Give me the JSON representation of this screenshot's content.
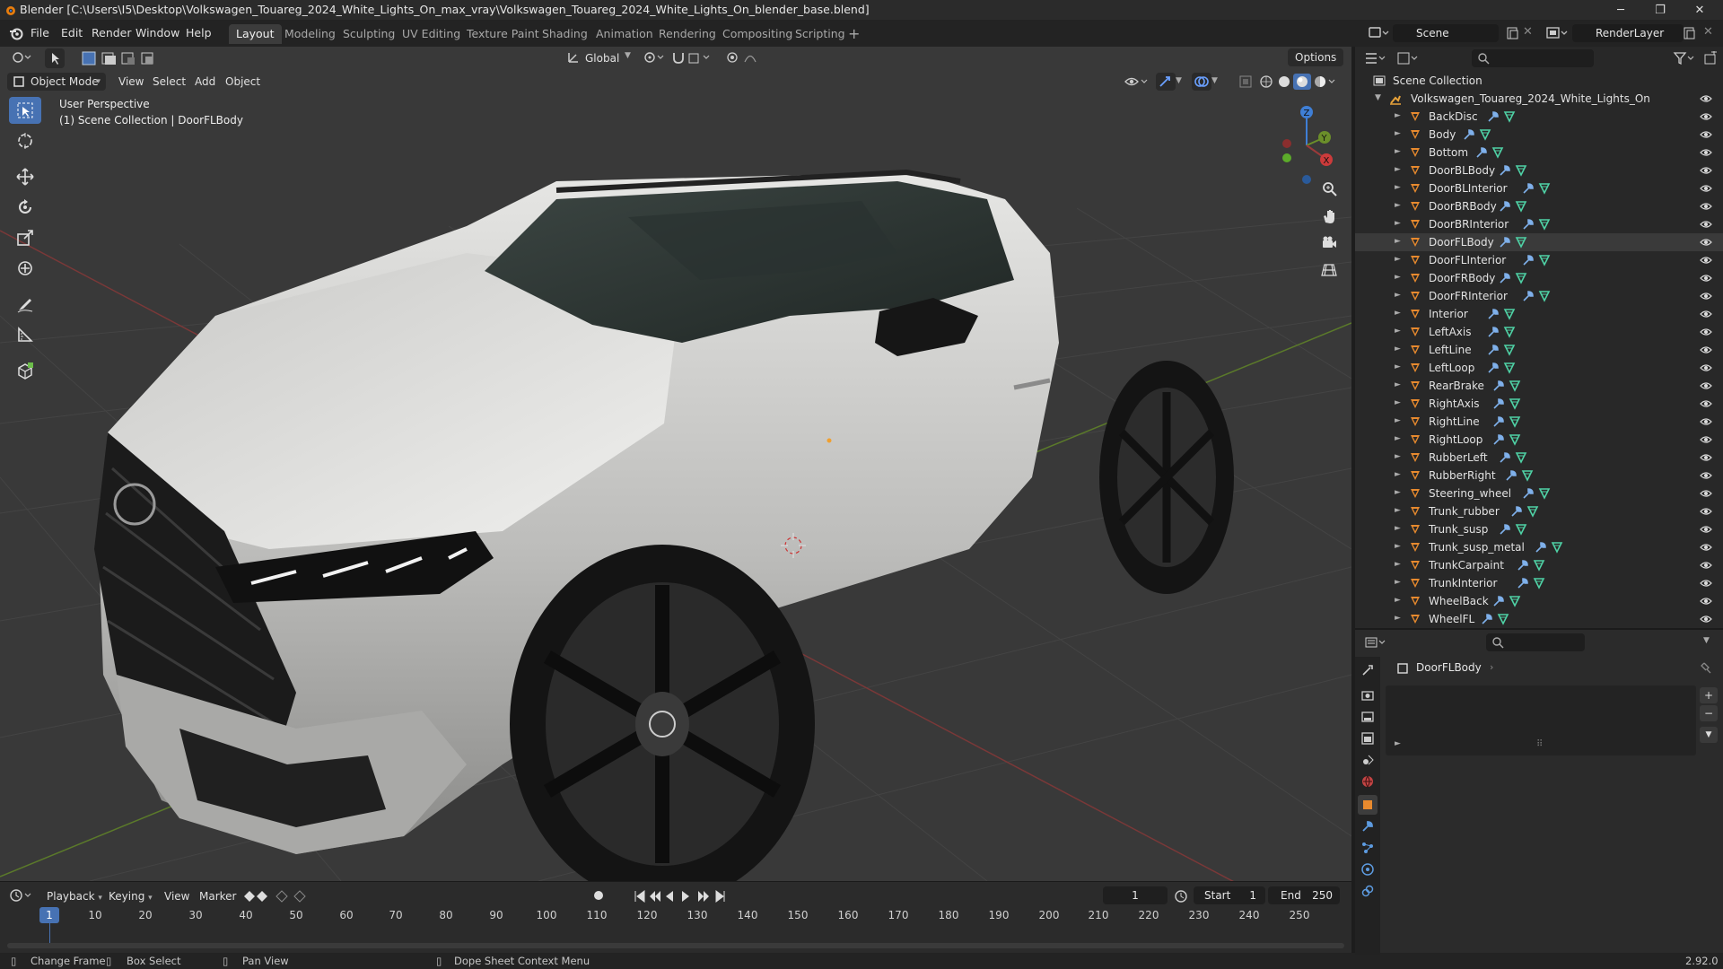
{
  "window": {
    "title": "Blender [C:\\Users\\I5\\Desktop\\Volkswagen_Touareg_2024_White_Lights_On_max_vray\\Volkswagen_Touareg_2024_White_Lights_On_blender_base.blend]",
    "controls": [
      "minimize",
      "maximize",
      "close"
    ]
  },
  "menu": [
    "File",
    "Edit",
    "Render",
    "Window",
    "Help"
  ],
  "workspaces": [
    {
      "label": "Layout",
      "active": true
    },
    {
      "label": "Modeling"
    },
    {
      "label": "Sculpting"
    },
    {
      "label": "UV Editing"
    },
    {
      "label": "Texture Paint"
    },
    {
      "label": "Shading"
    },
    {
      "label": "Animation"
    },
    {
      "label": "Rendering"
    },
    {
      "label": "Compositing"
    },
    {
      "label": "Scripting"
    }
  ],
  "scene": {
    "name": "Scene",
    "render_layer": "RenderLayer"
  },
  "viewport": {
    "mode": "Object Mode",
    "menus": [
      "View",
      "Select",
      "Add",
      "Object"
    ],
    "transform_orientation": "Global",
    "options_label": "Options",
    "overlay_line1": "User Perspective",
    "overlay_line2": "(1) Scene Collection | DoorFLBody",
    "tools": [
      "select-box",
      "cursor",
      "move",
      "rotate",
      "scale",
      "transform",
      "annotate",
      "measure",
      "add-cube"
    ],
    "gizmo_axes": [
      "X",
      "Y",
      "Z"
    ],
    "colors": {
      "background": "#393939",
      "x_axis": "#9b3a3a",
      "y_axis": "#6b8f2a",
      "z_axis": "#3f7fd6",
      "active_tool": "#4772b3"
    }
  },
  "outliner": {
    "root": "Scene Collection",
    "collection": "Volkswagen_Touareg_2024_White_Lights_On",
    "selected": "DoorFLBody",
    "objects": [
      "BackDisc",
      "Body",
      "Bottom",
      "DoorBLBody",
      "DoorBLInterior",
      "DoorBRBody",
      "DoorBRInterior",
      "DoorFLBody",
      "DoorFLInterior",
      "DoorFRBody",
      "DoorFRInterior",
      "Interior",
      "LeftAxis",
      "LeftLine",
      "LeftLoop",
      "RearBrake",
      "RightAxis",
      "RightLine",
      "RightLoop",
      "RubberLeft",
      "RubberRight",
      "Steering_wheel",
      "Trunk_rubber",
      "Trunk_susp",
      "Trunk_susp_metal",
      "TrunkCarpaint",
      "TrunkInterior",
      "WheelBack",
      "WheelFL"
    ]
  },
  "properties": {
    "object_name": "DoorFLBody",
    "tabs": [
      "tool",
      "render",
      "output",
      "view-layer",
      "scene",
      "world",
      "object",
      "modifiers",
      "particles",
      "physics",
      "constraints"
    ]
  },
  "timeline": {
    "menus": [
      "Playback",
      "Keying",
      "View",
      "Marker"
    ],
    "current_frame": "1",
    "start_label": "Start",
    "start": "1",
    "end_label": "End",
    "end": "250",
    "ticks": [
      "1",
      "10",
      "20",
      "30",
      "40",
      "50",
      "60",
      "70",
      "80",
      "90",
      "100",
      "110",
      "120",
      "130",
      "140",
      "150",
      "160",
      "170",
      "180",
      "190",
      "200",
      "210",
      "220",
      "230",
      "240",
      "250"
    ]
  },
  "statusbar": {
    "items": [
      "Change Frame",
      "Box Select",
      "Pan View",
      "Dope Sheet Context Menu"
    ],
    "version": "2.92.0"
  }
}
